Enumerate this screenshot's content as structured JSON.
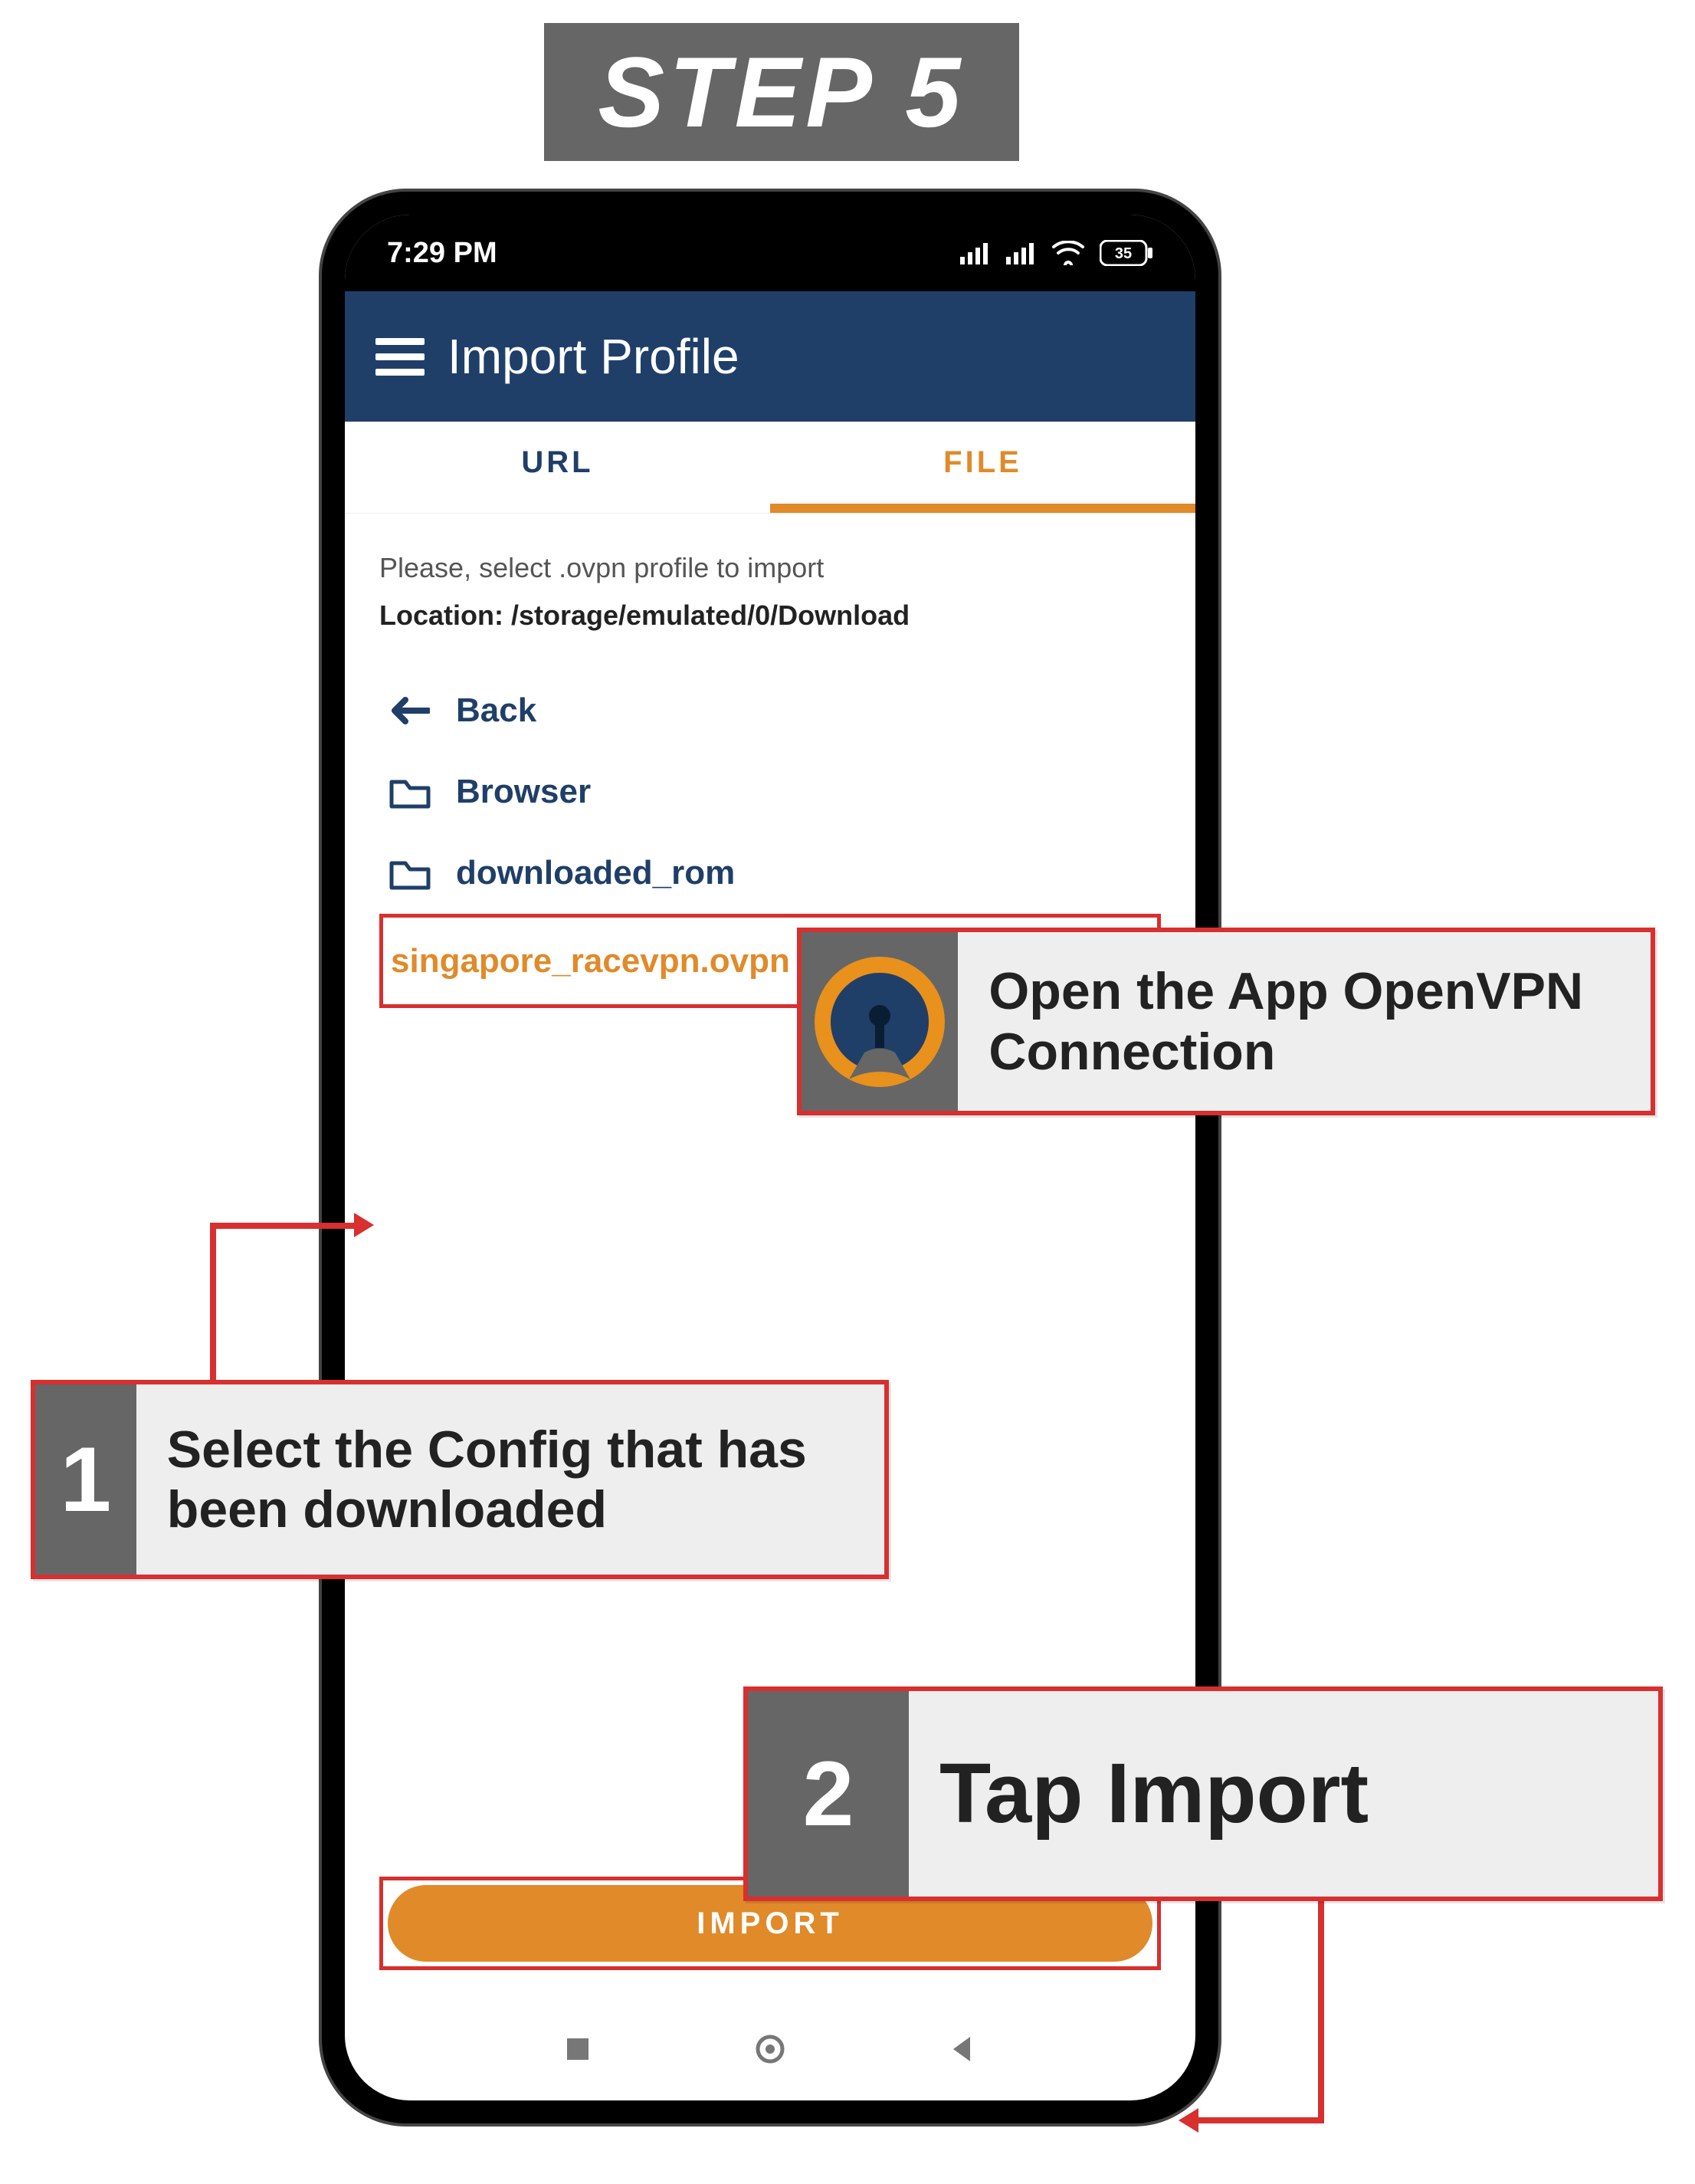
{
  "banner": {
    "title": "STEP 5"
  },
  "status": {
    "time": "7:29 PM",
    "battery": "35"
  },
  "header": {
    "title": "Import Profile"
  },
  "tabs": {
    "url": "URL",
    "file": "FILE"
  },
  "body": {
    "instruction": "Please, select .ovpn profile to import",
    "location_label": "Location: ",
    "location_path": "/storage/emulated/0/Download",
    "back_label": "Back",
    "folders": [
      "Browser",
      "downloaded_rom"
    ],
    "selected_file": "singapore_racevpn.ovpn"
  },
  "import_button": "IMPORT",
  "callouts": {
    "app": "Open the App OpenVPN Connection",
    "one_badge": "1",
    "one_text": "Select the Config that has been downloaded",
    "two_badge": "2",
    "two_text": "Tap Import"
  }
}
